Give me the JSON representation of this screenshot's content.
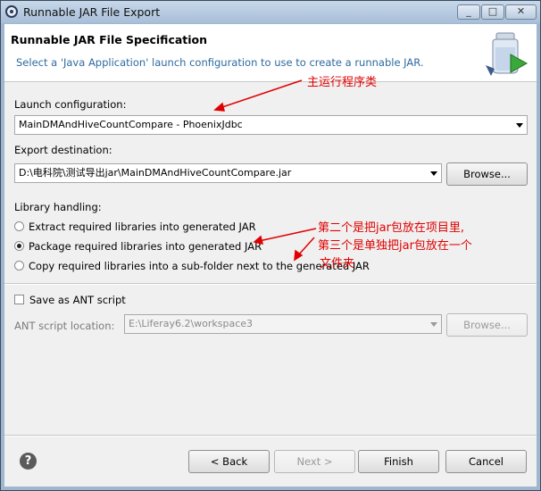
{
  "window": {
    "title": "Runnable JAR File Export",
    "controls": {
      "minimize": "_",
      "maximize": "□",
      "close": "✕"
    }
  },
  "header": {
    "title": "Runnable JAR File Specification",
    "subtitle": "Select a 'Java Application' launch configuration to use to create a runnable JAR."
  },
  "launch": {
    "label": "Launch configuration:",
    "value": "MainDMAndHiveCountCompare - PhoenixJdbc"
  },
  "export": {
    "label": "Export destination:",
    "value": "D:\\电科院\\测试导出jar\\MainDMAndHiveCountCompare.jar",
    "browse": "Browse..."
  },
  "library": {
    "label": "Library handling:",
    "options": [
      {
        "label": "Extract required libraries into generated JAR",
        "selected": false
      },
      {
        "label": "Package required libraries into generated JAR",
        "selected": true
      },
      {
        "label": "Copy required libraries into a sub-folder next to the generated JAR",
        "selected": false
      }
    ]
  },
  "ant": {
    "checkbox_label": "Save as ANT script",
    "location_label": "ANT script location:",
    "location_value": "E:\\Liferay6.2\\workspace3",
    "browse": "Browse..."
  },
  "footer": {
    "help": "?",
    "back": "< Back",
    "next": "Next >",
    "finish": "Finish",
    "cancel": "Cancel"
  },
  "annotations": {
    "main_class": "主运行程序类",
    "note_line1": "第二个是把jar包放在项目里,",
    "note_line2": "第三个是单独把jar包放在一个",
    "note_line3": "文件夹"
  },
  "colors": {
    "annotation": "#e00000",
    "subtitle": "#2f6aa0"
  }
}
